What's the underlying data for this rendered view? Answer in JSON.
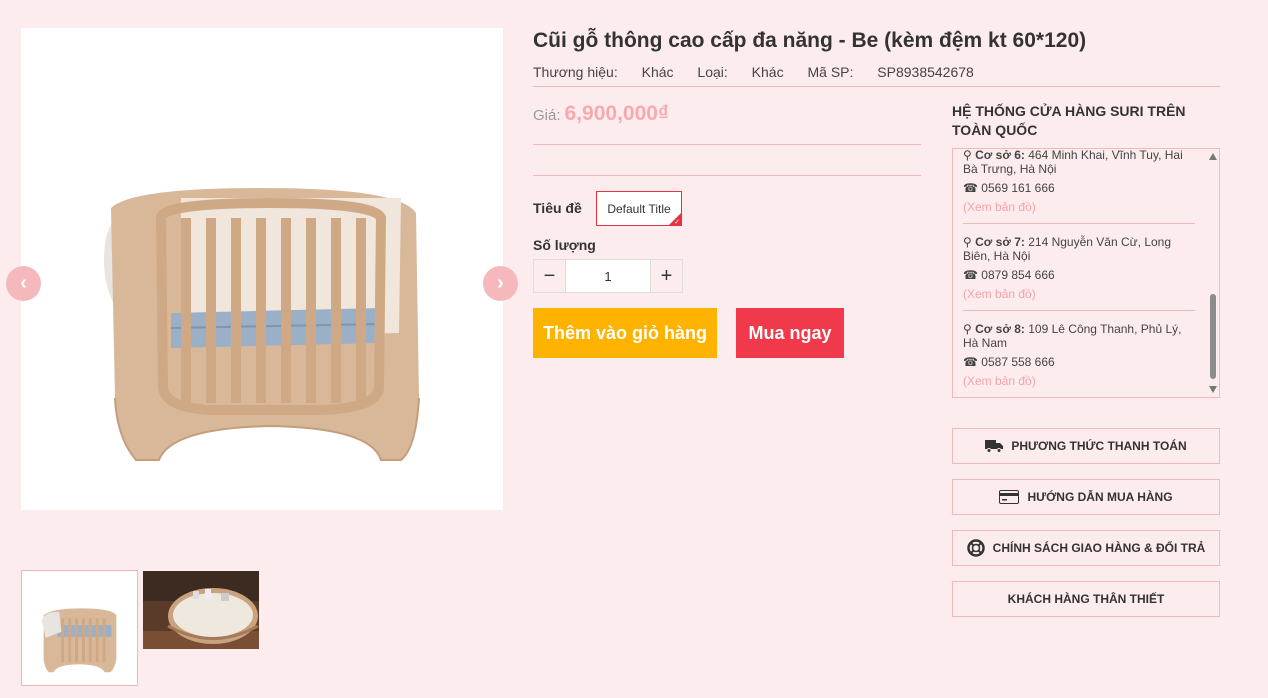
{
  "product": {
    "title": "Cũi gỗ thông cao cấp đa năng - Be (kèm đệm kt 60*120)",
    "brand_label": "Thương hiệu:",
    "brand_value": "Khác",
    "type_label": "Loại:",
    "type_value": "Khác",
    "sku_label": "Mã SP:",
    "sku_value": "SP8938542678",
    "price_label": "Giá:",
    "price_value": "6,900,000₫"
  },
  "variant": {
    "label": "Tiêu đề",
    "option": "Default Title"
  },
  "quantity": {
    "label": "Số lượng",
    "value": "1",
    "minus": "−",
    "plus": "+"
  },
  "buttons": {
    "add_to_cart": "Thêm vào giỏ hàng",
    "buy_now": "Mua ngay"
  },
  "stores": {
    "title": "HỆ THỐNG CỬA HÀNG SURI TRÊN TOÀN QUỐC",
    "items": [
      {
        "name": "Cơ sở 6:",
        "address": "464 Minh Khai, Vĩnh Tuy, Hai Bà Trưng, Hà Nội",
        "phone": "0569 161 666",
        "map": "(Xem bản đồ)"
      },
      {
        "name": "Cơ sở 7:",
        "address": "214 Nguyễn Văn Cừ, Long Biên, Hà Nội",
        "phone": "0879 854 666",
        "map": "(Xem bản đồ)"
      },
      {
        "name": "Cơ sở 8:",
        "address": "109 Lê Công Thanh, Phủ Lý, Hà Nam",
        "phone": "0587 558 666",
        "map": "(Xem bản đồ)"
      }
    ]
  },
  "policies": [
    {
      "label": "PHƯƠNG THỨC THANH TOÁN",
      "icon": "truck-icon"
    },
    {
      "label": "HƯỚNG DẪN MUA HÀNG",
      "icon": "credit-card-icon"
    },
    {
      "label": "CHÍNH SÁCH GIAO HÀNG & ĐỔI TRẢ",
      "icon": "lifebuoy-icon"
    },
    {
      "label": "KHÁCH HÀNG THÂN THIẾT",
      "icon": ""
    }
  ],
  "colors": {
    "background": "#fdeced",
    "price": "#f8a9b0",
    "add_to_cart": "#fdb300",
    "buy_now": "#f0394a",
    "accent_border": "#e0353f",
    "map_link": "#f3a3aa"
  },
  "icons": {
    "prev": "chevron-left-icon",
    "next": "chevron-right-icon",
    "map_pin": "map-marker-icon",
    "phone": "phone-icon"
  }
}
